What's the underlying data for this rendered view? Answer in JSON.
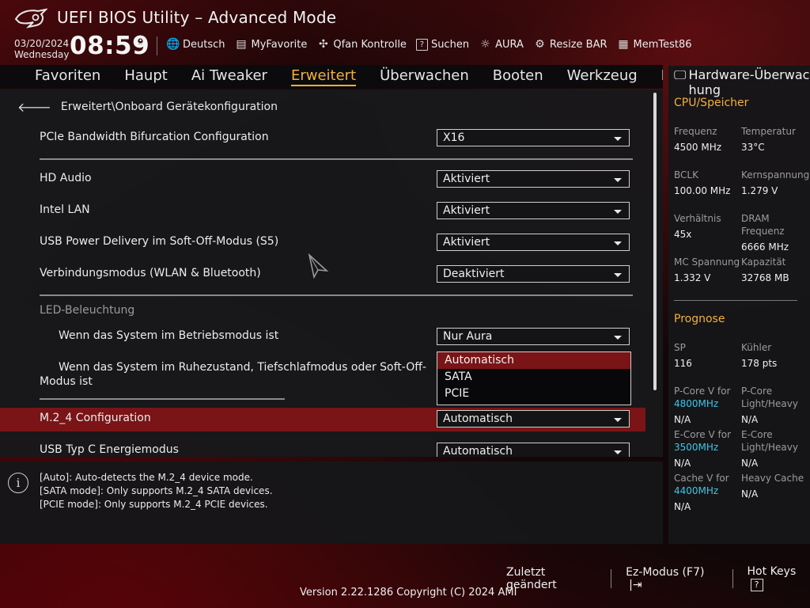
{
  "header": {
    "title": "UEFI BIOS Utility – Advanced Mode",
    "date": "03/20/2024",
    "weekday": "Wednesday",
    "time": "08:59"
  },
  "toolbar": [
    {
      "icon": "globe-icon",
      "glyph": "🌐",
      "label": "Deutsch"
    },
    {
      "icon": "favorite-icon",
      "glyph": "▤",
      "label": "MyFavorite"
    },
    {
      "icon": "fan-icon",
      "glyph": "✣",
      "label": "Qfan Kontrolle"
    },
    {
      "icon": "search-icon",
      "glyph": "?",
      "label": "Suchen"
    },
    {
      "icon": "aura-icon",
      "glyph": "☼",
      "label": "AURA"
    },
    {
      "icon": "resize-bar-icon",
      "glyph": "⚙",
      "label": "Resize BAR"
    },
    {
      "icon": "memtest-icon",
      "glyph": "▦",
      "label": "MemTest86"
    }
  ],
  "menu": [
    "Favoriten",
    "Haupt",
    "Ai Tweaker",
    "Erweitert",
    "Überwachen",
    "Booten",
    "Werkzeug",
    "E"
  ],
  "menu_active_index": 3,
  "breadcrumb": "Erweitert\\Onboard Gerätekonfiguration",
  "settings": {
    "pcie": {
      "label": "PCIe Bandwidth Bifurcation Configuration",
      "value": "X16"
    },
    "hd_audio": {
      "label": "HD Audio",
      "value": "Aktiviert"
    },
    "intel_lan": {
      "label": "Intel LAN",
      "value": "Aktiviert"
    },
    "usb_power": {
      "label": "USB Power Delivery im Soft-Off-Modus (S5)",
      "value": "Aktiviert"
    },
    "connection": {
      "label": "Verbindungsmodus (WLAN & Bluetooth)",
      "value": "Deaktiviert"
    },
    "led_section": "LED-Beleuchtung",
    "led_running": {
      "label": "Wenn das System im Betriebsmodus ist",
      "value": "Nur Aura"
    },
    "led_sleep": {
      "label": "Wenn das System im Ruhezustand, Tiefschlafmodus oder Soft-Off-Modus ist"
    },
    "m2_4": {
      "label": "M.2_4 Configuration",
      "value": "Automatisch"
    },
    "usb_c": {
      "label": "USB Typ C Energiemodus",
      "value": "Automatisch"
    }
  },
  "popup_options": [
    "Automatisch",
    "SATA",
    "PCIE"
  ],
  "popup_highlight": 0,
  "help_lines": [
    "[Auto]: Auto-detects the M.2_4 device mode.",
    "[SATA mode]: Only supports M.2_4 SATA devices.",
    "[PCIE mode]: Only supports M.2_4 PCIE devices."
  ],
  "hardware": {
    "title": "Hardware-Überwachung",
    "cpu_section": "CPU/Speicher",
    "frequency_label": "Frequenz",
    "frequency": "4500 MHz",
    "temperature_label": "Temperatur",
    "temperature": "33°C",
    "bclk_label": "BCLK",
    "bclk": "100.00 MHz",
    "core_voltage_label": "Kernspannung",
    "core_voltage": "1.279 V",
    "ratio_label": "Verhältnis",
    "ratio": "45x",
    "dram_label": "DRAM Frequenz",
    "dram": "6666 MHz",
    "mc_voltage_label": "MC Spannung",
    "mc_voltage": "1.332 V",
    "capacity_label": "Kapazität",
    "capacity": "32768 MB",
    "prognose_section": "Prognose",
    "sp_label": "SP",
    "sp": "116",
    "cooler_label": "Kühler",
    "cooler": "178 pts",
    "pcore_v_label": "P-Core V for",
    "pcore_v_freq": "4800MHz",
    "pcore_v": "N/A",
    "pcore_lh_label": "P-Core Light/Heavy",
    "pcore_lh": "N/A",
    "ecore_v_label": "E-Core V for",
    "ecore_v_freq": "3500MHz",
    "ecore_v": "N/A",
    "ecore_lh_label": "E-Core Light/Heavy",
    "ecore_lh": "N/A",
    "cache_v_label": "Cache V for",
    "cache_v_freq": "4400MHz",
    "cache_v": "N/A",
    "heavy_cache_label": "Heavy Cache",
    "heavy_cache": "N/A"
  },
  "footer": {
    "last_changed": "Zuletzt geändert",
    "ez_mode": "Ez-Modus (F7)",
    "hot_keys": "Hot Keys",
    "hot_keys_glyph": "?",
    "version": "Version 2.22.1286 Copyright (C) 2024 AMI"
  },
  "colors": {
    "accent": "#f3b03c",
    "selection": "#7a1417",
    "highlight_freq": "#3ec6e8"
  }
}
